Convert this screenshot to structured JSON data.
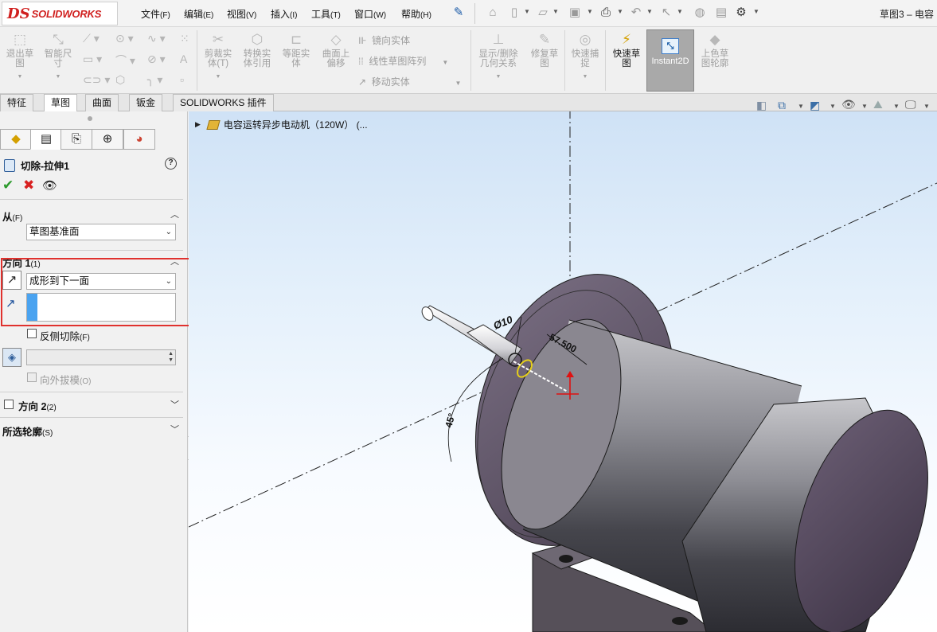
{
  "app": {
    "logo_ds": "DS",
    "logo_text": "SOLIDWORKS",
    "doc_title": "草图3 – 电容"
  },
  "menu": [
    {
      "label": "文件",
      "key": "(F)"
    },
    {
      "label": "编辑",
      "key": "(E)"
    },
    {
      "label": "视图",
      "key": "(V)"
    },
    {
      "label": "插入",
      "key": "(I)"
    },
    {
      "label": "工具",
      "key": "(T)"
    },
    {
      "label": "窗口",
      "key": "(W)"
    },
    {
      "label": "帮助",
      "key": "(H)"
    }
  ],
  "toolbar": {
    "exit_sketch": "退出草\n图",
    "smart_dim": "智能尺\n寸",
    "trim": "剪裁实\n体(T)",
    "convert": "转换实\n体引用",
    "offset": "等距实\n体",
    "surface_offset": "曲面上\n偏移",
    "mirror": "镜向实体",
    "linear_pattern": "线性草图阵列",
    "move": "移动实体",
    "show_delete": "显示/删除\n几何关系",
    "repair": "修复草\n图",
    "quick_snap": "快速捕\n捉",
    "rapid_sketch": "快速草\n图",
    "instant2d": "Instant2D",
    "shaded_contours": "上色草\n图轮廓"
  },
  "tabs": [
    "特征",
    "草图",
    "曲面",
    "钣金",
    "SOLIDWORKS 插件"
  ],
  "active_tab": 1,
  "property_manager": {
    "title": "切除-拉伸1",
    "help": "?",
    "from": {
      "label": "从",
      "key": "(F)",
      "value": "草图基准面"
    },
    "direction1": {
      "label": "方向 1",
      "key": "(1)",
      "end_condition": "成形到下一面"
    },
    "flip_side": {
      "label": "反侧切除",
      "key": "(F)",
      "checked": false
    },
    "draft_outward": {
      "label": "向外拔模",
      "key": "(O)",
      "checked": false,
      "enabled": false
    },
    "direction2": {
      "label": "方向 2",
      "key": "(2)",
      "checked": false
    },
    "selected_contours": {
      "label": "所选轮廓",
      "key": "(S)"
    }
  },
  "viewport": {
    "tree_node": "电容运转异步电动机（120W）   (...",
    "dimensions": {
      "diameter": "Ø10",
      "length": "57.500",
      "angle": "45°"
    }
  },
  "colors": {
    "highlight": "#e0312e",
    "accent_blue": "#4aa3f0",
    "ok_green": "#2c9a2c",
    "cancel_red": "#d82020"
  }
}
